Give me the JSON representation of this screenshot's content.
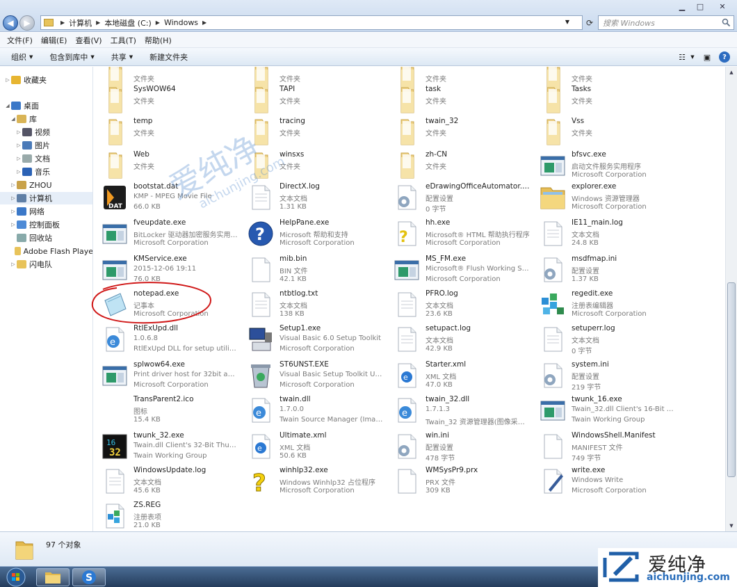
{
  "window": {
    "min": "▁",
    "max": "□",
    "close": "✕"
  },
  "address": {
    "crumbs": [
      "计算机",
      "本地磁盘 (C:)",
      "Windows"
    ],
    "search_placeholder": "搜索 Windows"
  },
  "menu": [
    "文件(F)",
    "编辑(E)",
    "查看(V)",
    "工具(T)",
    "帮助(H)"
  ],
  "toolbar": {
    "organize": "组织",
    "include": "包含到库中",
    "share": "共享",
    "new_folder": "新建文件夹"
  },
  "nav": [
    {
      "label": "收藏夹",
      "level": 0,
      "tri": "▷",
      "icon": "star-icon",
      "color": "#e7b531"
    },
    {
      "label": "桌面",
      "level": 0,
      "tri": "◢",
      "icon": "desktop-icon",
      "color": "#3b78c8"
    },
    {
      "label": "库",
      "level": 1,
      "tri": "◢",
      "icon": "library-icon",
      "color": "#d9b456"
    },
    {
      "label": "视频",
      "level": 2,
      "tri": "▷",
      "icon": "video-icon",
      "color": "#556"
    },
    {
      "label": "图片",
      "level": 2,
      "tri": "▷",
      "icon": "pictures-icon",
      "color": "#4a7ab8"
    },
    {
      "label": "文档",
      "level": 2,
      "tri": "▷",
      "icon": "documents-icon",
      "color": "#9aa"
    },
    {
      "label": "音乐",
      "level": 2,
      "tri": "▷",
      "icon": "music-icon",
      "color": "#2b62b5"
    },
    {
      "label": "ZHOU",
      "level": 1,
      "tri": "▷",
      "icon": "user-icon",
      "color": "#c9a24a"
    },
    {
      "label": "计算机",
      "level": 1,
      "tri": "▷",
      "icon": "computer-icon",
      "color": "#5f7fa6",
      "selected": true
    },
    {
      "label": "网络",
      "level": 1,
      "tri": "▷",
      "icon": "network-icon",
      "color": "#3b78c8"
    },
    {
      "label": "控制面板",
      "level": 1,
      "tri": "▷",
      "icon": "control-panel-icon",
      "color": "#4d8ad6"
    },
    {
      "label": "回收站",
      "level": 1,
      "tri": "",
      "icon": "recycle-bin-icon",
      "color": "#8aa"
    },
    {
      "label": "Adobe Flash Playe",
      "level": 1,
      "tri": "",
      "icon": "folder-icon",
      "color": "#e8c35a"
    },
    {
      "label": "闪电队",
      "level": 1,
      "tri": "▷",
      "icon": "folder-icon",
      "color": "#e8c35a"
    }
  ],
  "files": [
    {
      "name": "",
      "l2": "文件夹",
      "l3": "",
      "icon": "folder"
    },
    {
      "name": "",
      "l2": "文件夹",
      "l3": "",
      "icon": "folder"
    },
    {
      "name": "",
      "l2": "文件夹",
      "l3": "",
      "icon": "folder"
    },
    {
      "name": "",
      "l2": "文件夹",
      "l3": "",
      "icon": "folder"
    },
    {
      "name": "SysWOW64",
      "l2": "文件夹",
      "l3": "",
      "icon": "folder"
    },
    {
      "name": "TAPI",
      "l2": "文件夹",
      "l3": "",
      "icon": "folder"
    },
    {
      "name": "task",
      "l2": "文件夹",
      "l3": "",
      "icon": "folder"
    },
    {
      "name": "Tasks",
      "l2": "文件夹",
      "l3": "",
      "icon": "folder"
    },
    {
      "name": "temp",
      "l2": "文件夹",
      "l3": "",
      "icon": "folder"
    },
    {
      "name": "tracing",
      "l2": "文件夹",
      "l3": "",
      "icon": "folder"
    },
    {
      "name": "twain_32",
      "l2": "文件夹",
      "l3": "",
      "icon": "folder"
    },
    {
      "name": "Vss",
      "l2": "文件夹",
      "l3": "",
      "icon": "folder"
    },
    {
      "name": "Web",
      "l2": "文件夹",
      "l3": "",
      "icon": "folder"
    },
    {
      "name": "winsxs",
      "l2": "文件夹",
      "l3": "",
      "icon": "folder"
    },
    {
      "name": "zh-CN",
      "l2": "文件夹",
      "l3": "",
      "icon": "folder"
    },
    {
      "name": "bfsvc.exe",
      "l2": "启动文件服务实用程序",
      "l3": "Microsoft Corporation",
      "icon": "exe"
    },
    {
      "name": "bootstat.dat",
      "l2": "KMP - MPEG Movie File",
      "l3": "66.0 KB",
      "icon": "dat"
    },
    {
      "name": "DirectX.log",
      "l2": "文本文档",
      "l3": "1.31 KB",
      "icon": "doc"
    },
    {
      "name": "eDrawingOfficeAutomator.INI",
      "l2": "配置设置",
      "l3": "0 字节",
      "icon": "ini"
    },
    {
      "name": "explorer.exe",
      "l2": "Windows 资源管理器",
      "l3": "Microsoft Corporation",
      "icon": "explorer"
    },
    {
      "name": "fveupdate.exe",
      "l2": "BitLocker 驱动器加密服务实用工...",
      "l3": "Microsoft Corporation",
      "icon": "exe"
    },
    {
      "name": "HelpPane.exe",
      "l2": "Microsoft 帮助和支持",
      "l3": "Microsoft Corporation",
      "icon": "help"
    },
    {
      "name": "hh.exe",
      "l2": "Microsoft® HTML 帮助执行程序",
      "l3": "Microsoft Corporation",
      "icon": "hh"
    },
    {
      "name": "IE11_main.log",
      "l2": "文本文档",
      "l3": "24.8 KB",
      "icon": "doc"
    },
    {
      "name": "KMService.exe",
      "l2": "2015-12-06 19:11",
      "l3": "76.0 KB",
      "icon": "exe"
    },
    {
      "name": "mib.bin",
      "l2": "BIN 文件",
      "l3": "42.1 KB",
      "icon": "blank"
    },
    {
      "name": "MS_FM.exe",
      "l2": "Microsoft® Flush Working Set...",
      "l3": "Microsoft Corporation",
      "icon": "exe"
    },
    {
      "name": "msdfmap.ini",
      "l2": "配置设置",
      "l3": "1.37 KB",
      "icon": "ini"
    },
    {
      "name": "notepad.exe",
      "l2": "记事本",
      "l3": "Microsoft Corporation",
      "icon": "notepad"
    },
    {
      "name": "ntbtlog.txt",
      "l2": "文本文档",
      "l3": "138 KB",
      "icon": "doc"
    },
    {
      "name": "PFRO.log",
      "l2": "文本文档",
      "l3": "23.6 KB",
      "icon": "doc"
    },
    {
      "name": "regedit.exe",
      "l2": "注册表编辑器",
      "l3": "Microsoft Corporation",
      "icon": "regedit"
    },
    {
      "name": "RtlExUpd.dll",
      "l2": "1.0.6.8",
      "l3": "RtlExUpd DLL for setup utility f...",
      "icon": "dll"
    },
    {
      "name": "Setup1.exe",
      "l2": "Visual Basic 6.0 Setup Toolkit",
      "l3": "Microsoft Corporation",
      "icon": "setup"
    },
    {
      "name": "setupact.log",
      "l2": "文本文档",
      "l3": "42.9 KB",
      "icon": "doc"
    },
    {
      "name": "setuperr.log",
      "l2": "文本文档",
      "l3": "0 字节",
      "icon": "doc"
    },
    {
      "name": "splwow64.exe",
      "l2": "Print driver host for 32bit appl...",
      "l3": "Microsoft Corporation",
      "icon": "exe"
    },
    {
      "name": "ST6UNST.EXE",
      "l2": "Visual Basic Setup Toolkit Uni...",
      "l3": "Microsoft Corporation",
      "icon": "uninstall"
    },
    {
      "name": "Starter.xml",
      "l2": "XML 文档",
      "l3": "47.0 KB",
      "icon": "xml"
    },
    {
      "name": "system.ini",
      "l2": "配置设置",
      "l3": "219 字节",
      "icon": "ini"
    },
    {
      "name": "TransParent2.ico",
      "l2": "图标",
      "l3": "15.4 KB",
      "icon": "none"
    },
    {
      "name": "twain.dll",
      "l2": "1.7.0.0",
      "l3": "Twain Source Manager (Imag...",
      "icon": "dll"
    },
    {
      "name": "twain_32.dll",
      "l2": "1.7.1.3",
      "l3": "Twain_32 资源管理器(图像采集...",
      "icon": "dll"
    },
    {
      "name": "twunk_16.exe",
      "l2": "Twain_32.dll Client's 16-Bit Thu...",
      "l3": "Twain Working Group",
      "icon": "exe"
    },
    {
      "name": "twunk_32.exe",
      "l2": "Twain.dll Client's 32-Bit Thunki...",
      "l3": "Twain Working Group",
      "icon": "twunk32"
    },
    {
      "name": "Ultimate.xml",
      "l2": "XML 文档",
      "l3": "50.6 KB",
      "icon": "xml"
    },
    {
      "name": "win.ini",
      "l2": "配置设置",
      "l3": "478 字节",
      "icon": "ini"
    },
    {
      "name": "WindowsShell.Manifest",
      "l2": "MANIFEST 文件",
      "l3": "749 字节",
      "icon": "blank"
    },
    {
      "name": "WindowsUpdate.log",
      "l2": "文本文档",
      "l3": "45.6 KB",
      "icon": "doc"
    },
    {
      "name": "winhlp32.exe",
      "l2": "Windows Winhlp32 占位程序",
      "l3": "Microsoft Corporation",
      "icon": "winhlp"
    },
    {
      "name": "WMSysPr9.prx",
      "l2": "PRX 文件",
      "l3": "309 KB",
      "icon": "blank"
    },
    {
      "name": "write.exe",
      "l2": "Windows Write",
      "l3": "Microsoft Corporation",
      "icon": "write"
    },
    {
      "name": "ZS.REG",
      "l2": "注册表项",
      "l3": "21.0 KB",
      "icon": "reg"
    }
  ],
  "status": {
    "count": "97 个对象"
  },
  "watermark": {
    "brand": "爱纯净",
    "url": "aichunjing.com",
    "center_text": "爱纯净",
    "center_url": "aichunjing.com"
  }
}
